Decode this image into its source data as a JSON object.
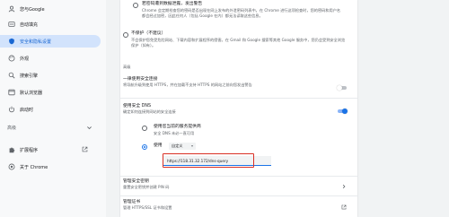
{
  "sidebar": {
    "items": [
      {
        "label": "您与Google",
        "icon": "person-icon"
      },
      {
        "label": "自动填充",
        "icon": "autofill-icon"
      },
      {
        "label": "安全和隐私设置",
        "icon": "shield-icon",
        "active": true
      },
      {
        "label": "外观",
        "icon": "palette-icon"
      },
      {
        "label": "搜索引擎",
        "icon": "search-icon"
      },
      {
        "label": "默认浏览器",
        "icon": "browser-icon"
      },
      {
        "label": "启动时",
        "icon": "power-icon"
      }
    ],
    "advanced_label": "高级",
    "extensions_label": "扩展程序",
    "about_label": "关于 Chrome"
  },
  "main": {
    "top_option": {
      "title": "若密码遭到数据泄露，发出警告",
      "desc": "Chrome 会定期检查您的密码是否出现在网上发布的外泄密码列表中。在 Chrome 进行这项检查时，您的密码和用户名都会经过加密，因此任何人（包括 Google 在内）都无法读取这些信息。"
    },
    "no_protection": {
      "title": "不保护（不建议）",
      "desc": "不会保护您免受危险网站、下载内容和扩展程序的侵害。在 Gmail 和 Google 搜索等其他 Google 服务中，您仍会受到安全浏览保护（如有）。"
    },
    "advanced_heading": "高级",
    "https_option": {
      "title": "一律使用安全连接",
      "desc": "将导航升级到使用 HTTPS，并在加载不支持 HTTPS 的网站之前向您发出警告"
    },
    "dns_option": {
      "title": "使用安全 DNS",
      "desc": "确定如何连接到网站的安全连接"
    },
    "dns_current_provider": {
      "title": "使用您当前的服务提供商",
      "desc": "安全 DNS 未必一直可用"
    },
    "dns_custom": {
      "label": "使用",
      "select_value": "自定义",
      "input_value": "https://118.31.32.172/dns-query"
    },
    "manage_certs": {
      "title": "管理安全密钥",
      "desc": "重置安全密钥并创建 PIN 码"
    },
    "manage_certificates": {
      "title": "管理证书",
      "desc": "管理 HTTPS/SSL 证书和设置"
    }
  },
  "colors": {
    "accent": "#1a73e8",
    "highlight": "#d93025",
    "active_nav_bg": "#d2e3fc"
  }
}
